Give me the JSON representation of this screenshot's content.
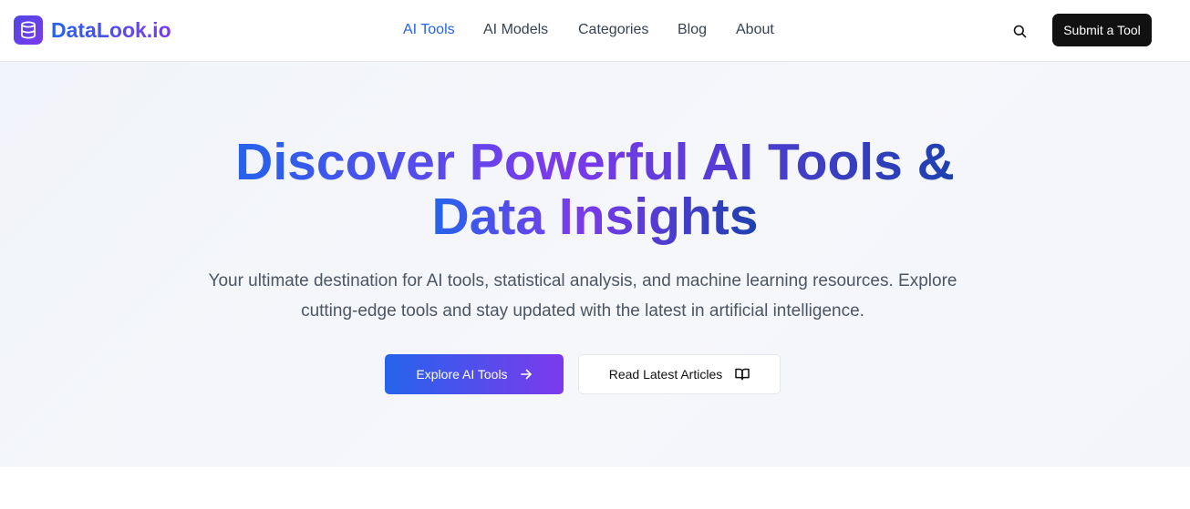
{
  "brand": {
    "name": "DataLook.io",
    "logo_icon": "database-icon",
    "accent": "#2563eb",
    "accent2": "#7c3aed"
  },
  "nav": {
    "items": [
      {
        "label": "AI Tools",
        "active": true
      },
      {
        "label": "AI Models",
        "active": false
      },
      {
        "label": "Categories",
        "active": false
      },
      {
        "label": "Blog",
        "active": false
      },
      {
        "label": "About",
        "active": false
      }
    ],
    "search_icon": "search-icon",
    "submit_label": "Submit a Tool"
  },
  "hero": {
    "title_line1": "Discover Powerful AI Tools &",
    "title_line2": "Data Insights",
    "subtitle_line1": "Your ultimate destination for AI tools, statistical analysis, and machine learning resources. Explore",
    "subtitle_line2": "cutting-edge tools and stay updated with the latest in artificial intelligence.",
    "primary_button": {
      "label": "Explore AI Tools",
      "icon": "arrow-right-icon"
    },
    "secondary_button": {
      "label": "Read Latest Articles",
      "icon": "book-open-icon"
    }
  }
}
